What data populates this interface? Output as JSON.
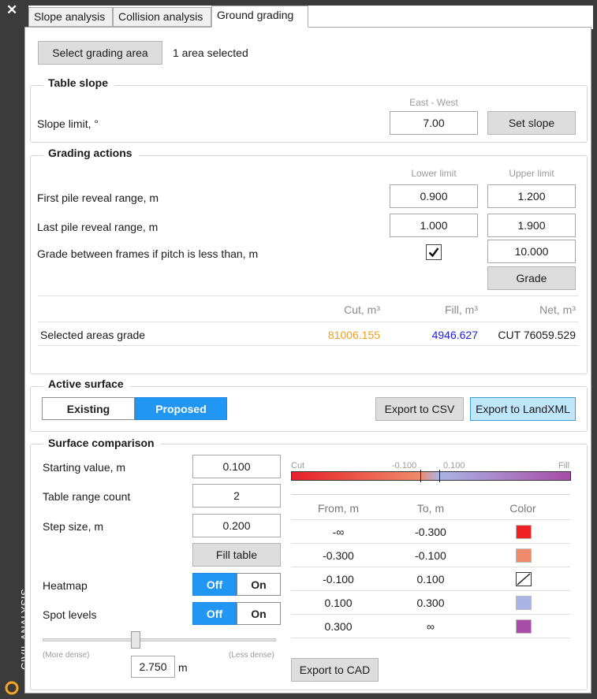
{
  "sidebar": {
    "title": "CIVIL ANALYSIS"
  },
  "tabs": [
    {
      "label": "Slope analysis"
    },
    {
      "label": "Collision analysis"
    },
    {
      "label": "Ground grading"
    }
  ],
  "area": {
    "button": "Select grading area",
    "status": "1 area selected"
  },
  "table_slope": {
    "title": "Table slope",
    "direction": "East - West",
    "label": "Slope limit, °",
    "value": "7.00",
    "button": "Set slope"
  },
  "grading": {
    "title": "Grading actions",
    "lower_header": "Lower limit",
    "upper_header": "Upper limit",
    "rows": [
      {
        "label": "First pile reveal range, m",
        "lower": "0.900",
        "upper": "1.200"
      },
      {
        "label": "Last pile reveal range, m",
        "lower": "1.000",
        "upper": "1.900"
      }
    ],
    "frames_label": "Grade between frames if pitch is less than, m",
    "frames_checked": true,
    "frames_value": "10.000",
    "grade_button": "Grade",
    "results": {
      "cut_header": "Cut, m³",
      "fill_header": "Fill, m³",
      "net_header": "Net, m³",
      "row_label": "Selected areas grade",
      "cut": "81006.155",
      "fill": "4946.627",
      "net": "CUT 76059.529",
      "cut_color": "#f0a020",
      "fill_color": "#2020e0"
    }
  },
  "active_surface": {
    "title": "Active surface",
    "options": [
      "Existing",
      "Proposed"
    ],
    "selected": "Proposed",
    "export_csv": "Export to CSV",
    "export_landxml": "Export to LandXML"
  },
  "comparison": {
    "title": "Surface comparison",
    "starting_label": "Starting value, m",
    "starting_value": "0.100",
    "range_label": "Table range count",
    "range_value": "2",
    "step_label": "Step size, m",
    "step_value": "0.200",
    "fill_button": "Fill table",
    "heatmap_label": "Heatmap",
    "spot_label": "Spot levels",
    "toggle_off": "Off",
    "toggle_on": "On",
    "heatmap_state": "Off",
    "spot_state": "Off",
    "slider_min_label": "(More dense)",
    "slider_max_label": "(Less dense)",
    "slider_position": 0.4,
    "density_value": "2.750",
    "density_unit": "m",
    "gradient": {
      "cut_label": "Cut",
      "fill_label": "Fill",
      "low_label": "-0.100",
      "high_label": "0.100"
    },
    "table": {
      "headers": [
        "From, m",
        "To, m",
        "Color"
      ],
      "rows": [
        {
          "from": "-∞",
          "to": "-0.300",
          "color": "#ee2222"
        },
        {
          "from": "-0.300",
          "to": "-0.100",
          "color": "#f08a6a"
        },
        {
          "from": "-0.100",
          "to": "0.100",
          "color": "none"
        },
        {
          "from": "0.100",
          "to": "0.300",
          "color": "#aab4e6"
        },
        {
          "from": "0.300",
          "to": "∞",
          "color": "#a84ca8"
        }
      ]
    },
    "export_cad": "Export to CAD"
  }
}
